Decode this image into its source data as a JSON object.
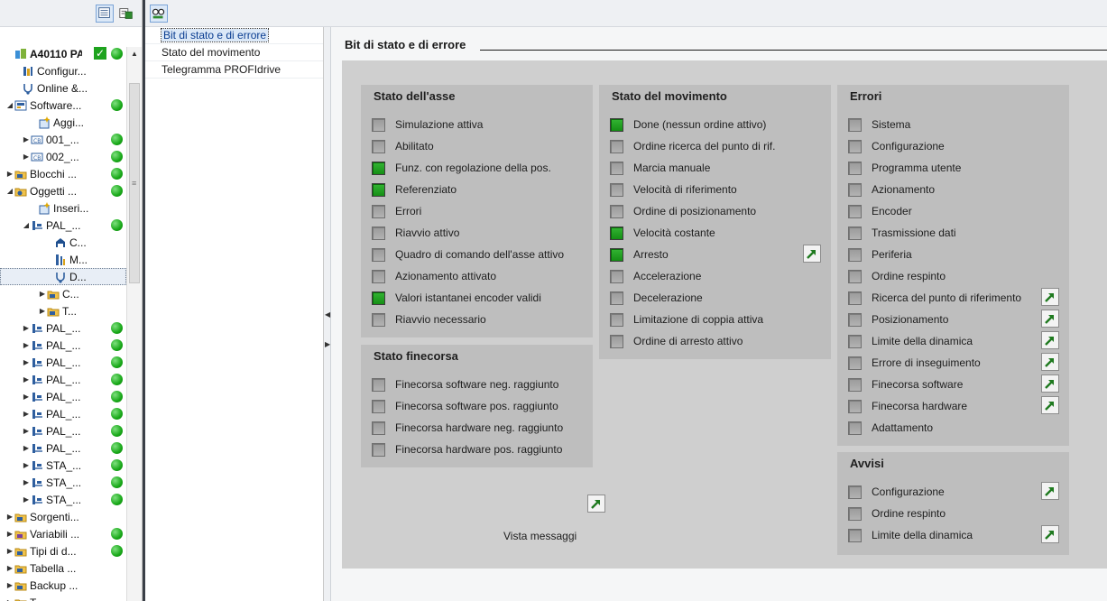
{
  "tree": {
    "rows": [
      {
        "label": "A40110 PA...",
        "bold": true,
        "arrow": "",
        "icon": "plc-station-icon",
        "status": true,
        "check": true
      },
      {
        "label": "Configur...",
        "arrow": "",
        "icon": "device-config-icon",
        "status": false
      },
      {
        "label": "Online &...",
        "arrow": "",
        "icon": "online-diagnostics-icon",
        "status": false
      },
      {
        "label": "Software...",
        "arrow": "down",
        "icon": "software-icon",
        "status": true
      },
      {
        "label": "Aggi...",
        "arrow": "",
        "icon": "add-new-icon",
        "status": false
      },
      {
        "label": "001_...",
        "arrow": "right",
        "icon": "block-icon",
        "status": true
      },
      {
        "label": "002_...",
        "arrow": "right",
        "icon": "block-icon",
        "status": true
      },
      {
        "label": "Blocchi ...",
        "arrow": "right",
        "icon": "folder-icon",
        "status": true
      },
      {
        "label": "Oggetti ...",
        "arrow": "down",
        "icon": "technology-folder-icon",
        "status": true
      },
      {
        "label": "Inseri...",
        "arrow": "",
        "icon": "add-new-icon",
        "status": false
      },
      {
        "label": "PAL_...",
        "arrow": "down",
        "icon": "axis-icon",
        "status": true
      },
      {
        "label": "C...",
        "arrow": "",
        "icon": "config-icon",
        "status": false
      },
      {
        "label": "M...",
        "arrow": "",
        "icon": "commissioning-icon",
        "status": false
      },
      {
        "label": "D...",
        "arrow": "",
        "icon": "diagnostics-icon",
        "status": false,
        "selected": true
      },
      {
        "label": "C...",
        "arrow": "right",
        "icon": "folder-icon",
        "status": false
      },
      {
        "label": "T...",
        "arrow": "right",
        "icon": "folder-icon",
        "status": false
      },
      {
        "label": "PAL_...",
        "arrow": "right",
        "icon": "axis-icon",
        "status": true
      },
      {
        "label": "PAL_...",
        "arrow": "right",
        "icon": "axis-icon",
        "status": true
      },
      {
        "label": "PAL_...",
        "arrow": "right",
        "icon": "axis-icon",
        "status": true
      },
      {
        "label": "PAL_...",
        "arrow": "right",
        "icon": "axis-icon",
        "status": true
      },
      {
        "label": "PAL_...",
        "arrow": "right",
        "icon": "axis-icon",
        "status": true
      },
      {
        "label": "PAL_...",
        "arrow": "right",
        "icon": "axis-icon",
        "status": true
      },
      {
        "label": "PAL_...",
        "arrow": "right",
        "icon": "axis-icon",
        "status": true
      },
      {
        "label": "PAL_...",
        "arrow": "right",
        "icon": "axis-icon",
        "status": true
      },
      {
        "label": "STA_...",
        "arrow": "right",
        "icon": "axis-icon",
        "status": true
      },
      {
        "label": "STA_...",
        "arrow": "right",
        "icon": "axis-icon",
        "status": true
      },
      {
        "label": "STA_...",
        "arrow": "right",
        "icon": "axis-icon",
        "status": true
      },
      {
        "label": "Sorgenti...",
        "arrow": "right",
        "icon": "folder-icon",
        "status": false
      },
      {
        "label": "Variabili ...",
        "arrow": "right",
        "icon": "tags-icon",
        "status": true
      },
      {
        "label": "Tipi di d...",
        "arrow": "right",
        "icon": "folder-icon",
        "status": true
      },
      {
        "label": "Tabella ...",
        "arrow": "right",
        "icon": "folder-icon",
        "status": false
      },
      {
        "label": "Backup ...",
        "arrow": "right",
        "icon": "folder-icon",
        "status": false
      },
      {
        "label": "T...",
        "arrow": "right",
        "icon": "folder-icon",
        "status": false
      }
    ]
  },
  "nav": {
    "items": [
      "Bit di stato e di errore",
      "Stato del movimento",
      "Telegramma PROFIdrive"
    ],
    "active_index": 0
  },
  "content": {
    "section_title": "Bit di stato e di errore",
    "groups": {
      "axis_status": {
        "title": "Stato dell'asse",
        "items": [
          {
            "label": "Simulazione attiva",
            "on": false
          },
          {
            "label": "Abilitato",
            "on": false
          },
          {
            "label": "Funz. con regolazione della pos.",
            "on": true
          },
          {
            "label": "Referenziato",
            "on": true
          },
          {
            "label": "Errori",
            "on": false
          },
          {
            "label": "Riavvio attivo",
            "on": false
          },
          {
            "label": "Quadro di comando dell'asse attivo",
            "on": false
          },
          {
            "label": "Azionamento attivato",
            "on": false
          },
          {
            "label": "Valori istantanei encoder validi",
            "on": true
          },
          {
            "label": "Riavvio necessario",
            "on": false
          }
        ]
      },
      "limit_switch_status": {
        "title": "Stato finecorsa",
        "items": [
          {
            "label": "Finecorsa software neg. raggiunto",
            "on": false
          },
          {
            "label": "Finecorsa software pos. raggiunto",
            "on": false
          },
          {
            "label": "Finecorsa hardware neg. raggiunto",
            "on": false
          },
          {
            "label": "Finecorsa hardware pos. raggiunto",
            "on": false
          }
        ]
      },
      "motion_status": {
        "title": "Stato del movimento",
        "items": [
          {
            "label": "Done (nessun ordine attivo)",
            "on": true
          },
          {
            "label": "Ordine ricerca del punto di rif.",
            "on": false
          },
          {
            "label": "Marcia manuale",
            "on": false
          },
          {
            "label": "Velocità di riferimento",
            "on": false
          },
          {
            "label": "Ordine di posizionamento",
            "on": false
          },
          {
            "label": "Velocità costante",
            "on": true
          },
          {
            "label": "Arresto",
            "on": true,
            "goto": true
          },
          {
            "label": "Accelerazione",
            "on": false
          },
          {
            "label": "Decelerazione",
            "on": false
          },
          {
            "label": "Limitazione di coppia attiva",
            "on": false
          },
          {
            "label": "Ordine di arresto attivo",
            "on": false
          }
        ]
      },
      "errors": {
        "title": "Errori",
        "items": [
          {
            "label": "Sistema",
            "on": false
          },
          {
            "label": "Configurazione",
            "on": false
          },
          {
            "label": "Programma utente",
            "on": false
          },
          {
            "label": "Azionamento",
            "on": false
          },
          {
            "label": "Encoder",
            "on": false
          },
          {
            "label": "Trasmissione dati",
            "on": false
          },
          {
            "label": "Periferia",
            "on": false
          },
          {
            "label": "Ordine respinto",
            "on": false
          },
          {
            "label": "Ricerca del punto di riferimento",
            "on": false,
            "goto": true
          },
          {
            "label": "Posizionamento",
            "on": false,
            "goto": true
          },
          {
            "label": "Limite della dinamica",
            "on": false,
            "goto": true
          },
          {
            "label": "Errore di inseguimento",
            "on": false,
            "goto": true
          },
          {
            "label": "Finecorsa software",
            "on": false,
            "goto": true
          },
          {
            "label": "Finecorsa hardware",
            "on": false,
            "goto": true
          },
          {
            "label": "Adattamento",
            "on": false
          }
        ]
      },
      "warnings": {
        "title": "Avvisi",
        "items": [
          {
            "label": "Configurazione",
            "on": false,
            "goto": true
          },
          {
            "label": "Ordine respinto",
            "on": false
          },
          {
            "label": "Limite della dinamica",
            "on": false,
            "goto": true
          }
        ]
      }
    },
    "message_view_label": "Vista messaggi"
  },
  "colors": {
    "led_on": "#1a9a1a",
    "status_ok": "#18a818",
    "panel_bg": "#cfcfcf",
    "group_bg": "#bebebe"
  }
}
